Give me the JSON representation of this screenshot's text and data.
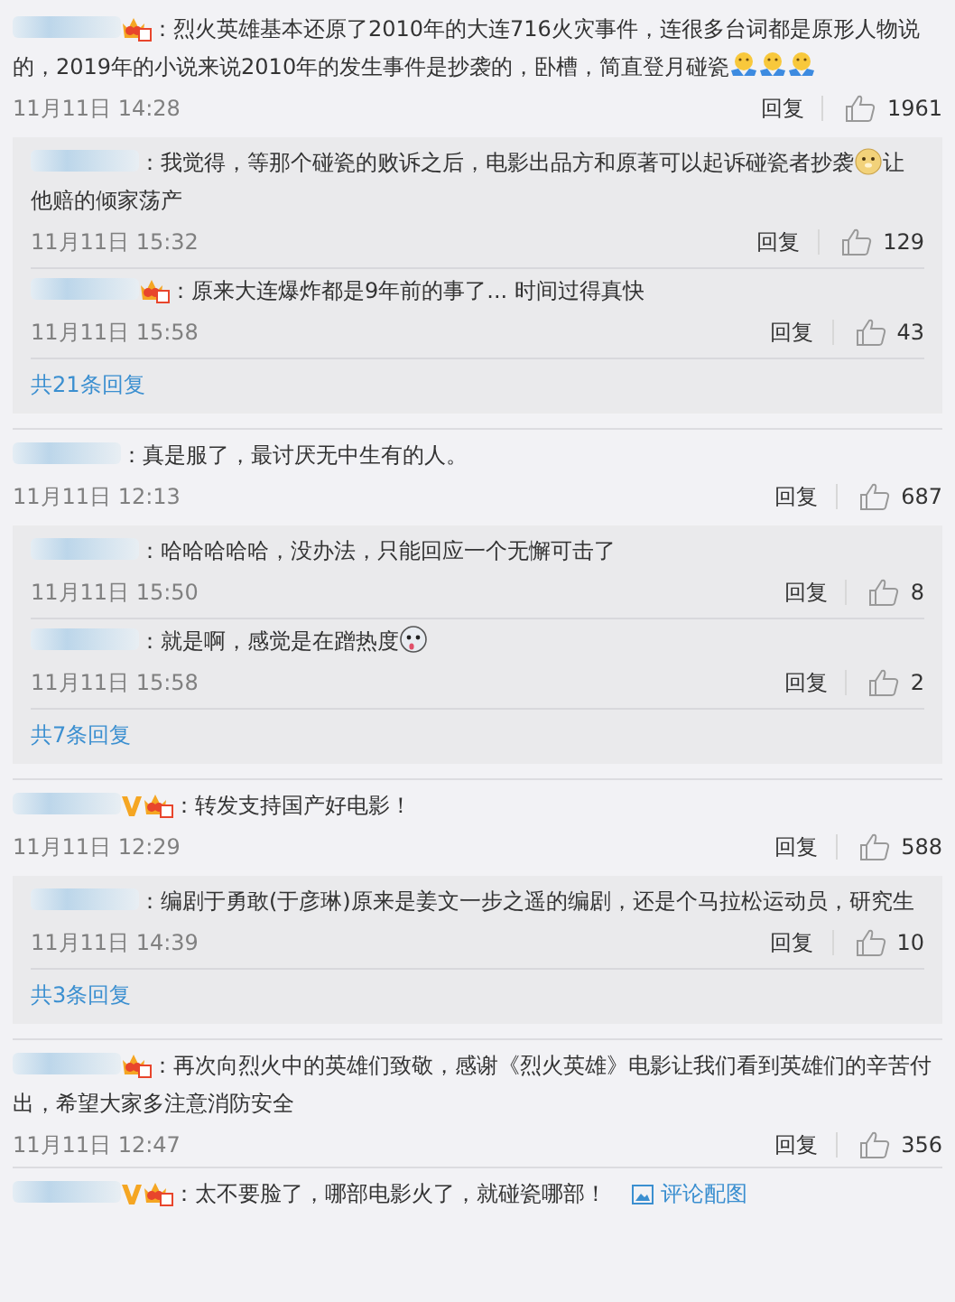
{
  "comments": [
    {
      "verified": false,
      "member": true,
      "body": [
        {
          "kind": "text",
          "text": "：烈火英雄基本还原了2010年的大连716火灾事件，连很多台词都是原形人物说的，2019年的小说来说2010年的发生事件是抄袭的，卧槽，简直登月碰瓷"
        },
        {
          "kind": "hug"
        },
        {
          "kind": "hug"
        },
        {
          "kind": "hug"
        }
      ],
      "date": "11月11日 14:28",
      "reply": "回复",
      "likes": "1961",
      "replies": [
        {
          "verified": false,
          "member": false,
          "body": [
            {
              "kind": "text",
              "text": "：我觉得，等那个碰瓷的败诉之后，电影出品方和原著可以起诉碰瓷者抄袭"
            },
            {
              "kind": "doge"
            },
            {
              "kind": "text",
              "text": "让他赔的倾家荡产"
            }
          ],
          "date": "11月11日 15:32",
          "reply": "回复",
          "likes": "129"
        },
        {
          "verified": false,
          "member": true,
          "body": [
            {
              "kind": "text",
              "text": "：原来大连爆炸都是9年前的事了... 时间过得真快"
            }
          ],
          "date": "11月11日 15:58",
          "reply": "回复",
          "likes": "43"
        }
      ],
      "more": "共21条回复"
    },
    {
      "verified": false,
      "member": false,
      "body": [
        {
          "kind": "text",
          "text": "：真是服了，最讨厌无中生有的人。"
        }
      ],
      "date": "11月11日 12:13",
      "reply": "回复",
      "likes": "687",
      "replies": [
        {
          "verified": false,
          "member": false,
          "body": [
            {
              "kind": "text",
              "text": "：哈哈哈哈哈，没办法，只能回应一个无懈可击了"
            }
          ],
          "date": "11月11日 15:50",
          "reply": "回复",
          "likes": "8"
        },
        {
          "verified": false,
          "member": false,
          "body": [
            {
              "kind": "text",
              "text": "：就是啊，感觉是在蹭热度"
            },
            {
              "kind": "husky"
            }
          ],
          "date": "11月11日 15:58",
          "reply": "回复",
          "likes": "2"
        }
      ],
      "more": "共7条回复"
    },
    {
      "verified": true,
      "member": true,
      "body": [
        {
          "kind": "text",
          "text": "：转发支持国产好电影！"
        }
      ],
      "date": "11月11日 12:29",
      "reply": "回复",
      "likes": "588",
      "replies": [
        {
          "verified": false,
          "member": false,
          "body": [
            {
              "kind": "text",
              "text": "：编剧于勇敢(于彦琳)原来是姜文一步之遥的编剧，还是个马拉松运动员，研究生"
            }
          ],
          "date": "11月11日 14:39",
          "reply": "回复",
          "likes": "10"
        }
      ],
      "more": "共3条回复"
    },
    {
      "verified": false,
      "member": true,
      "body": [
        {
          "kind": "text",
          "text": "：再次向烈火中的英雄们致敬，感谢《烈火英雄》电影让我们看到英雄们的辛苦付出，希望大家多注意消防安全"
        }
      ],
      "date": "11月11日 12:47",
      "reply": "回复",
      "likes": "356"
    },
    {
      "verified": true,
      "member": true,
      "body": [
        {
          "kind": "text",
          "text": "：太不要脸了，哪部电影火了，就碰瓷哪部！"
        }
      ],
      "image_link": "评论配图"
    }
  ]
}
